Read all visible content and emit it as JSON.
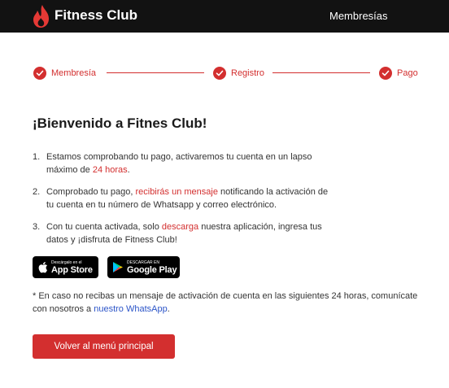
{
  "header": {
    "brand": "Fitness Club",
    "nav": "Membresías"
  },
  "stepper": {
    "steps": [
      {
        "label": "Membresía"
      },
      {
        "label": "Registro"
      },
      {
        "label": "Pago"
      }
    ],
    "accent_color": "#d32f2f"
  },
  "main": {
    "title": "¡Bienvenido a Fitnes Club!",
    "steps": [
      {
        "num": "1.",
        "before": "Estamos comprobando tu pago, activaremos tu cuenta en un lapso máximo de ",
        "highlight": "24 horas",
        "after": "."
      },
      {
        "num": "2.",
        "before": "Comprobado tu pago, ",
        "highlight": "recibirás un mensaje",
        "after": " notificando la activación de tu cuenta en tu número de Whatsapp y correo electrónico."
      },
      {
        "num": "3.",
        "before": "Con tu cuenta activada, solo ",
        "highlight": "descarga",
        "after": " nuestra aplicación, ingresa tus datos y ¡disfruta de Fitness Club!"
      }
    ],
    "stores": {
      "apple_small": "Descárgalo en el",
      "apple_big": "App Store",
      "apple_icon": "apple-icon",
      "google_small": "DESCARGAR EN",
      "google_big": "Google Play",
      "google_icon": "google-play-icon"
    },
    "note": {
      "before": "* En caso no recibas un mensaje de activación de cuenta en las siguientes 24 horas, comunícate con nosotros a ",
      "link": "nuestro WhatsApp",
      "after": "."
    },
    "button": "Volver al menú principal"
  }
}
